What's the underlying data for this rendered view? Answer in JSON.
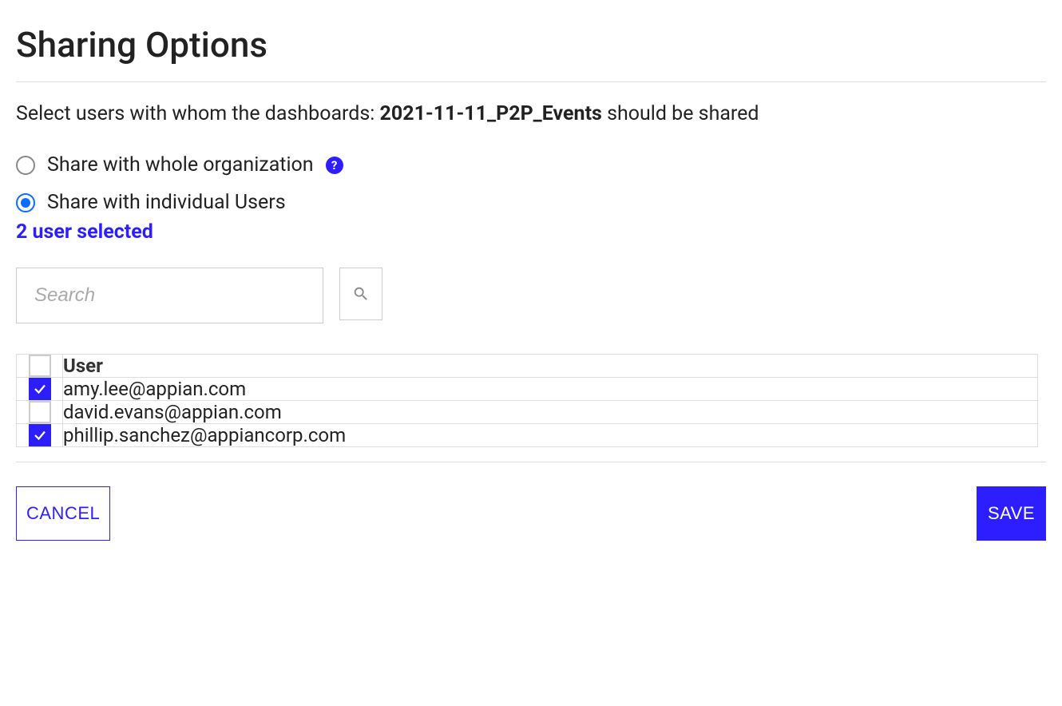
{
  "title": "Sharing Options",
  "subtitle_prefix": "Select users with whom the dashboards: ",
  "subtitle_bold": "2021-11-11_P2P_Events",
  "subtitle_suffix": " should be shared",
  "share_options": {
    "whole_org_label": "Share with whole organization",
    "individuals_label": "Share with individual Users",
    "selected": "individuals"
  },
  "selected_count_text": "2 user selected",
  "search": {
    "placeholder": "Search",
    "value": ""
  },
  "table": {
    "header": "User",
    "rows": [
      {
        "email": "amy.lee@appian.com",
        "checked": true
      },
      {
        "email": "david.evans@appian.com",
        "checked": false
      },
      {
        "email": "phillip.sanchez@appiancorp.com",
        "checked": true
      }
    ]
  },
  "buttons": {
    "cancel": "CANCEL",
    "save": "SAVE"
  },
  "colors": {
    "primary": "#2d1eff",
    "radio_selected": "#0a6cff"
  }
}
